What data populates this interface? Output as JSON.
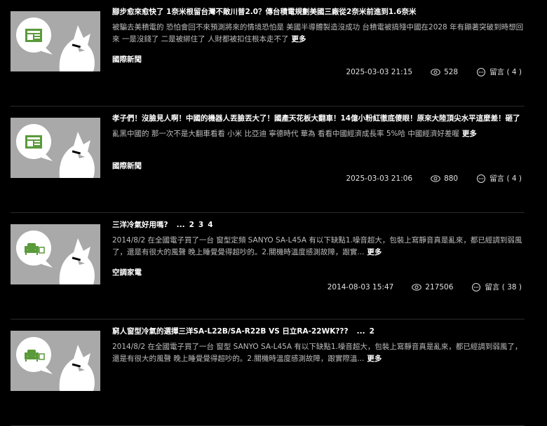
{
  "posts": [
    {
      "title": "腳步愈來愈快了 1奈米根留台灣不敵川普2.0？傳台積電規劃美國三廠從2奈米前進到1.6奈米",
      "pages": [],
      "excerpt": "被騙去美積電的 恐怕會回不來預測將來的情境恐怕是 美國半導體製造沒成功 台積電被搞殘中國在2028 年有顯著突破到時想回來 一是沒錢了 二是被綁住了 人財都被扣住根本走不了",
      "more": "更多",
      "category": "國際新聞",
      "date": "2025-03-03 21:15",
      "views": "528",
      "comments": "留言 ( 4 )",
      "thumb_icon": "newspaper-icon"
    },
    {
      "title": "孝子們！沒臉見人啊！中國的機器人丟臉丟大了！國產天花板大翻車！14億小粉紅徹底傻眼！原來大陸頂尖水平這麼差！砸了",
      "pages": [],
      "excerpt": "亂黑中國的 那一次不是大翻車看看 小米 比亞迪 寧德時代 華為 看看中國經濟成長率 5%哈 中國經濟好差喔",
      "more": "更多",
      "category": "國際新聞",
      "date": "2025-03-03 21:06",
      "views": "880",
      "comments": "留言 ( 4 )",
      "thumb_icon": "newspaper-icon"
    },
    {
      "title": "三洋冷氣好用嗎?",
      "pages_prefix": "...",
      "pages": [
        "2",
        "3",
        "4"
      ],
      "excerpt": "2014/8/2 在全國電子買了一台 窗型定頻 SANYO SA-L45A 有以下缺點1.噪音超大，包裝上寫靜音真是亂來，都已經調到弱風了，還是有很大的風聲 晚上睡覺覺得超吵的。2.關機時溫度感測故障，跟實...",
      "more": "更多",
      "category": "空調家電",
      "date": "2014-08-03 15:47",
      "views": "217506",
      "comments": "留言 ( 38 )",
      "thumb_icon": "armchair-tv-icon"
    },
    {
      "title": "窮人窗型冷氣的選擇三洋SA-L22B/SA-R22B VS 日立RA-22WK???",
      "pages_prefix": "...",
      "pages": [
        "2"
      ],
      "excerpt": "2014/8/2 在全國電子買了一台 窗型 SANYO SA-L45A 有以下缺點1.噪音超大，包裝上寫靜音真是亂來，都已經調到弱風了，還是有很大的風聲 晚上睡覺覺得超吵的。2.關機時溫度感測故障，跟實際溫...",
      "more": "更多",
      "category": "空調家電",
      "date": "",
      "views": "",
      "comments": "",
      "thumb_icon": "armchair-tv-icon"
    }
  ]
}
